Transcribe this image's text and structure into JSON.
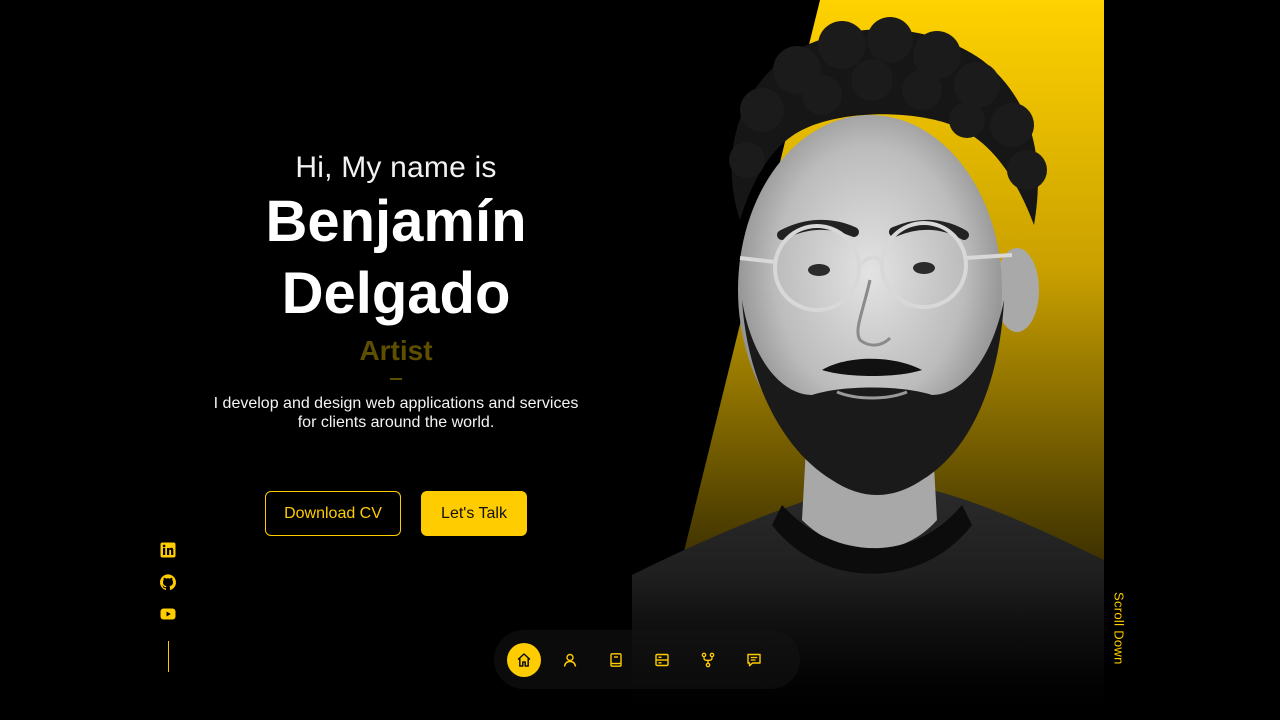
{
  "hero": {
    "greeting": "Hi, My name is",
    "first_name": "Benjamín",
    "last_name": "Delgado",
    "role": "Artist",
    "tagline_line1": "I develop and design web applications and services",
    "tagline_line2": "for clients around the world.",
    "photo_icon": "portrait-photo"
  },
  "cta": {
    "download_cv": "Download CV",
    "lets_talk": "Let's Talk"
  },
  "socials": [
    {
      "name": "linkedin",
      "icon": "linkedin-icon"
    },
    {
      "name": "github",
      "icon": "github-icon"
    },
    {
      "name": "youtube",
      "icon": "youtube-icon"
    }
  ],
  "nav": {
    "items": [
      {
        "id": "home",
        "icon": "home-icon",
        "active": true
      },
      {
        "id": "about",
        "icon": "user-icon",
        "active": false
      },
      {
        "id": "experience",
        "icon": "book-icon",
        "active": false
      },
      {
        "id": "services",
        "icon": "server-icon",
        "active": false
      },
      {
        "id": "portfolio",
        "icon": "git-fork-icon",
        "active": false
      },
      {
        "id": "contact",
        "icon": "message-icon",
        "active": false
      }
    ]
  },
  "scroll": {
    "label": "Scroll Down"
  },
  "colors": {
    "accent": "#ffcc00",
    "background": "#000000",
    "role_dim": "#5e4e00"
  }
}
